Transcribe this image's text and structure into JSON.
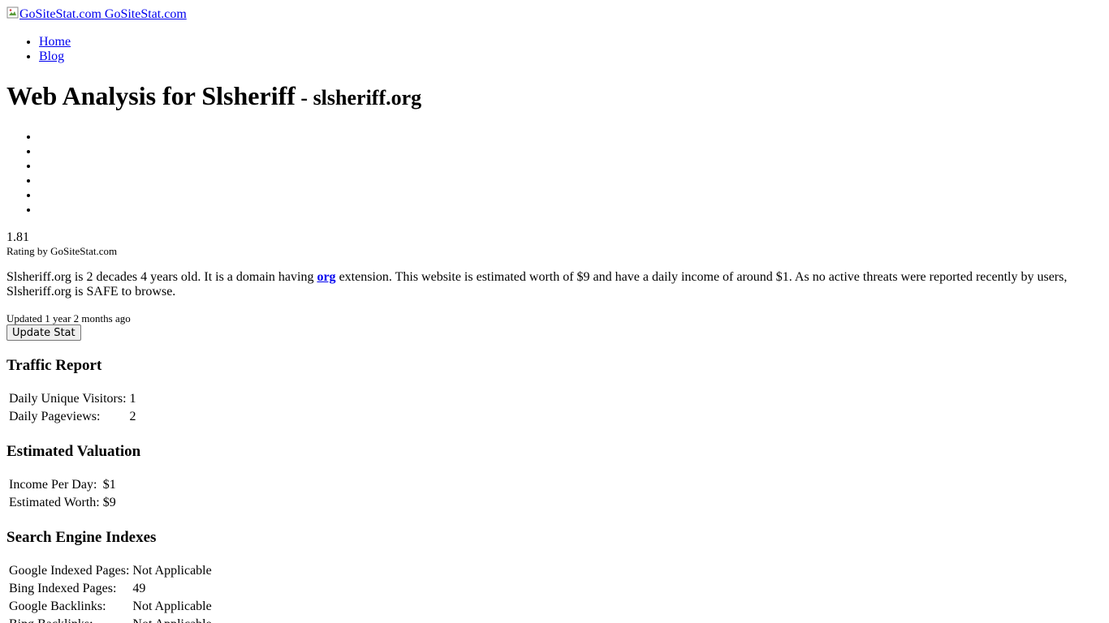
{
  "header": {
    "logo_alt": "GoSiteStat.com",
    "logo_text": "GoSiteStat.com"
  },
  "nav": {
    "items": [
      {
        "label": "Home"
      },
      {
        "label": "Blog"
      }
    ]
  },
  "title": {
    "main": "Web Analysis for Slsheriff",
    "separator": " - ",
    "domain": "slsheriff.org"
  },
  "rating": {
    "value": "1.81",
    "by": "Rating by GoSiteStat.com"
  },
  "summary": {
    "part1": "Slsheriff.org is 2 decades 4 years old. It is a domain having ",
    "link": "org",
    "part2": " extension. This website is estimated worth of $9 and have a daily income of around $1. As no active threats were reported recently by users, Slsheriff.org is SAFE to browse."
  },
  "updated": {
    "text": "Updated 1 year 2 months ago",
    "button": "Update Stat"
  },
  "traffic": {
    "heading": "Traffic Report",
    "rows": [
      {
        "label": "Daily Unique Visitors:",
        "value": "1"
      },
      {
        "label": "Daily Pageviews:",
        "value": "2"
      }
    ]
  },
  "valuation": {
    "heading": "Estimated Valuation",
    "rows": [
      {
        "label": "Income Per Day:",
        "value": "$1"
      },
      {
        "label": "Estimated Worth:",
        "value": "$9"
      }
    ]
  },
  "indexes": {
    "heading": "Search Engine Indexes",
    "rows": [
      {
        "label": "Google Indexed Pages:",
        "value": "Not Applicable"
      },
      {
        "label": "Bing Indexed Pages:",
        "value": "49"
      },
      {
        "label": "Google Backlinks:",
        "value": "Not Applicable"
      },
      {
        "label": "Bing Backlinks:",
        "value": "Not Applicable"
      }
    ]
  }
}
